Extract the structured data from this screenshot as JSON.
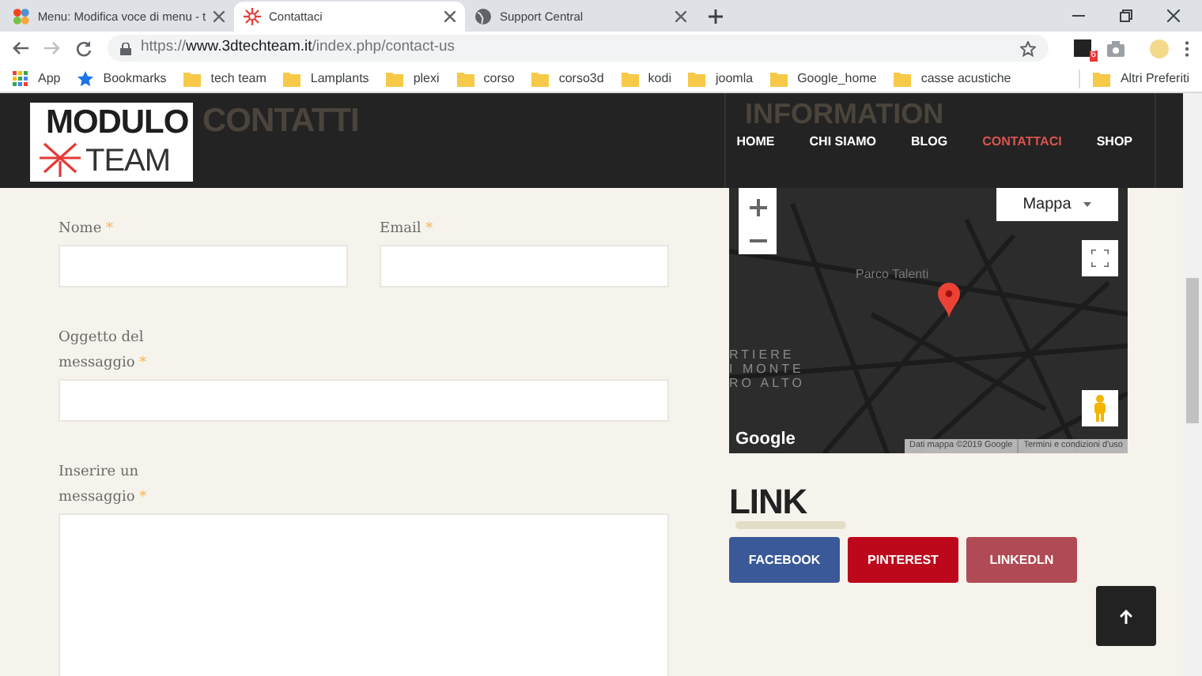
{
  "tabs": [
    {
      "title": "Menu: Modifica voce di menu - t",
      "selected": false,
      "kind": "joomla"
    },
    {
      "title": "Contattaci",
      "selected": true,
      "kind": "site"
    },
    {
      "title": "Support Central",
      "selected": false,
      "kind": "globe"
    }
  ],
  "address": {
    "scheme": "https://",
    "host": "www.3dtechteam.it",
    "path": "/index.php/contact-us"
  },
  "extension_badge": "6",
  "bookmarks": [
    {
      "label": "App",
      "kind": "apps"
    },
    {
      "label": "Bookmarks",
      "kind": "star"
    },
    {
      "label": "tech team",
      "kind": "folder"
    },
    {
      "label": "Lamplants",
      "kind": "folder"
    },
    {
      "label": "plexi",
      "kind": "folder"
    },
    {
      "label": "corso",
      "kind": "folder"
    },
    {
      "label": "corso3d",
      "kind": "folder"
    },
    {
      "label": "kodi",
      "kind": "folder"
    },
    {
      "label": "joomla",
      "kind": "folder"
    },
    {
      "label": "Google_home",
      "kind": "folder"
    },
    {
      "label": "casse acustiche",
      "kind": "folder"
    }
  ],
  "other_bookmarks": "Altri Preferiti",
  "logo": {
    "text": "TEAM"
  },
  "page_heading": [
    "MODULO",
    "CONTATTI"
  ],
  "side_heading": "INFORMATION",
  "nav": [
    {
      "label": "HOME",
      "selected": false
    },
    {
      "label": "CHI SIAMO",
      "selected": false
    },
    {
      "label": "BLOG",
      "selected": false
    },
    {
      "label": "CONTATTACI",
      "selected": true
    },
    {
      "label": "SHOP",
      "selected": false
    }
  ],
  "form": [
    {
      "label": "Nome",
      "marker": "*",
      "kind": "input"
    },
    {
      "label": "Email",
      "marker": "*",
      "kind": "input"
    },
    {
      "label": "Oggetto del messaggio",
      "marker": "*",
      "kind": "input"
    },
    {
      "label": "Inserire un messaggio",
      "marker": "*",
      "kind": "textarea"
    }
  ],
  "map": {
    "type_control": "Mappa",
    "labels": [
      "Parco Talenti",
      "RTIERE",
      "I MONTE",
      "RO ALTO"
    ],
    "brand": "Google",
    "data_credit": "Dati mappa ©2019 Google",
    "terms": "Termini e condizioni d'uso"
  },
  "links_heading": "LINK",
  "link_buttons": [
    {
      "label": "FACEBOOK",
      "color": "#3b5998"
    },
    {
      "label": "PINTEREST",
      "color": "#bd081c"
    },
    {
      "label": "LINKEDLN",
      "color": "#b04a54"
    }
  ]
}
